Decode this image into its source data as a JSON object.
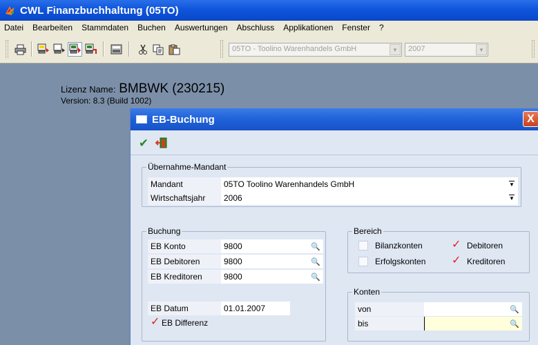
{
  "app": {
    "title": "CWL Finanzbuchhaltung (05TO)"
  },
  "menu": [
    {
      "label": "Datei"
    },
    {
      "label": "Bearbeiten"
    },
    {
      "label": "Stammdaten"
    },
    {
      "label": "Buchen"
    },
    {
      "label": "Auswertungen"
    },
    {
      "label": "Abschluss"
    },
    {
      "label": "Applikationen"
    },
    {
      "label": "Fenster"
    },
    {
      "label": "?"
    }
  ],
  "toolbar": {
    "mandant_combo": "05TO - Toolino Warenhandels GmbH",
    "year_combo": "2007",
    "icons": [
      "printer-icon",
      "booking-icon",
      "booking2-icon",
      "journal-icon",
      "ledger-icon",
      "calculator-icon",
      "cut-icon",
      "copy-icon",
      "paste-icon"
    ]
  },
  "info": {
    "license_prefix": "Lizenz Name:",
    "license_name": "BMBWK (230215)",
    "version": "Version: 8.3 (Build 1002)"
  },
  "dialog": {
    "title": "EB-Buchung",
    "close_label": "X",
    "uebernahme": {
      "legend": "Übernahme-Mandant",
      "mandant_label": "Mandant",
      "mandant_value": "05TO Toolino Warenhandels GmbH",
      "wj_label": "Wirtschaftsjahr",
      "wj_value": "2006"
    },
    "buchung": {
      "legend": "Buchung",
      "eb_konto_label": "EB Konto",
      "eb_konto_value": "9800",
      "eb_debitoren_label": "EB Debitoren",
      "eb_debitoren_value": "9800",
      "eb_kreditoren_label": "EB Kreditoren",
      "eb_kreditoren_value": "9800",
      "eb_datum_label": "EB Datum",
      "eb_datum_value": "01.01.2007",
      "eb_differenz_label": "EB Differenz",
      "eb_differenz_checked": true
    },
    "bereich": {
      "legend": "Bereich",
      "bilanzkonten": "Bilanzkonten",
      "bilanzkonten_checked": false,
      "erfolgskonten": "Erfolgskonten",
      "erfolgskonten_checked": false,
      "debitoren": "Debitoren",
      "debitoren_checked": true,
      "kreditoren": "Kreditoren",
      "kreditoren_checked": true
    },
    "konten": {
      "legend": "Konten",
      "von_label": "von",
      "von_value": "",
      "bis_label": "bis",
      "bis_value": ""
    }
  },
  "colors": {
    "titlebar": "#0f55dc",
    "workspace": "#7c8fa9",
    "dialog_bg": "#dfe7f3",
    "check_red": "#e02020",
    "active_field": "#ffffdc"
  }
}
